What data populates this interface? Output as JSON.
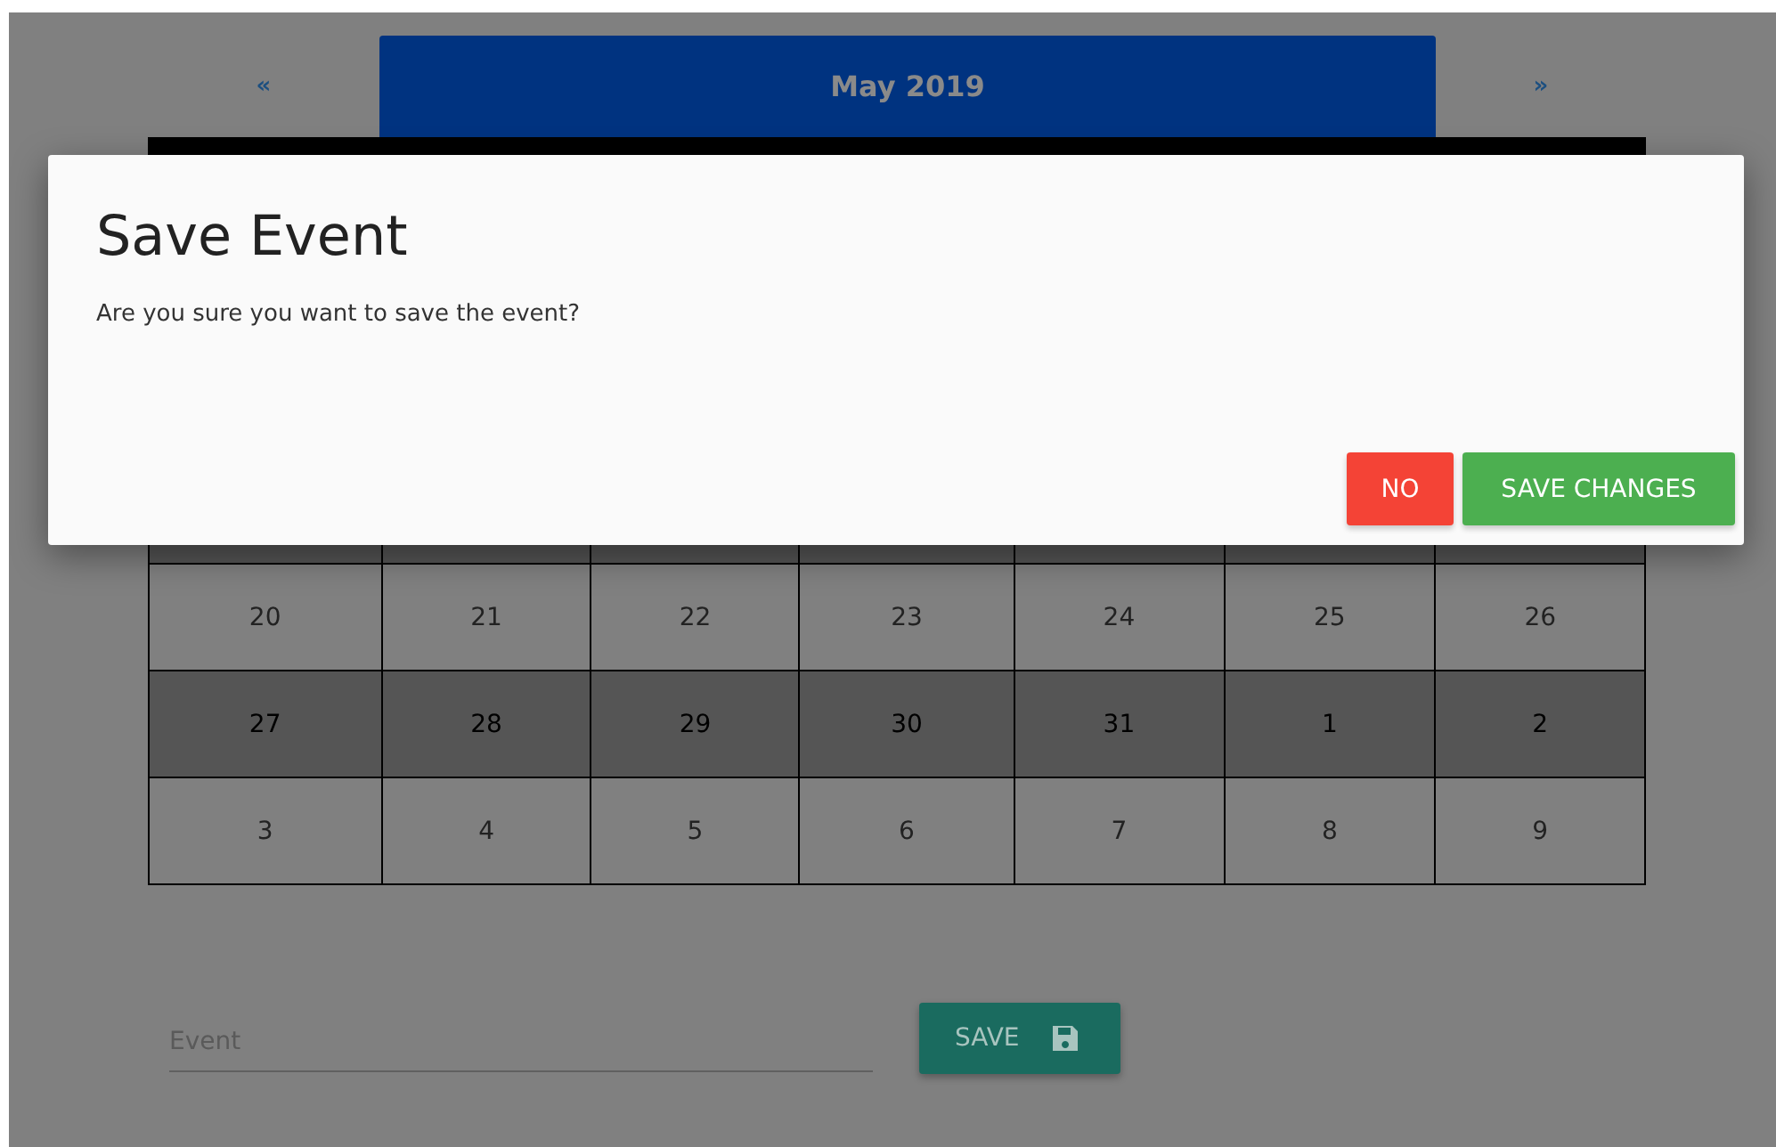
{
  "calendar": {
    "prev": "«",
    "title": "May 2019",
    "next": "»",
    "weeks": [
      {
        "days": [
          "20",
          "21",
          "22",
          "23",
          "24",
          "25",
          "26"
        ]
      },
      {
        "days": [
          "27",
          "28",
          "29",
          "30",
          "31",
          "1",
          "2"
        ]
      },
      {
        "days": [
          "3",
          "4",
          "5",
          "6",
          "7",
          "8",
          "9"
        ]
      }
    ]
  },
  "dialog": {
    "title": "Save Event",
    "message": "Are you sure you want to save the event?",
    "buttons": [
      {
        "label": "NO",
        "kind": "cancel"
      },
      {
        "label": "SAVE CHANGES",
        "kind": "confirm"
      }
    ]
  },
  "event_form": {
    "placeholder": "Event",
    "save_button": "SAVE"
  }
}
